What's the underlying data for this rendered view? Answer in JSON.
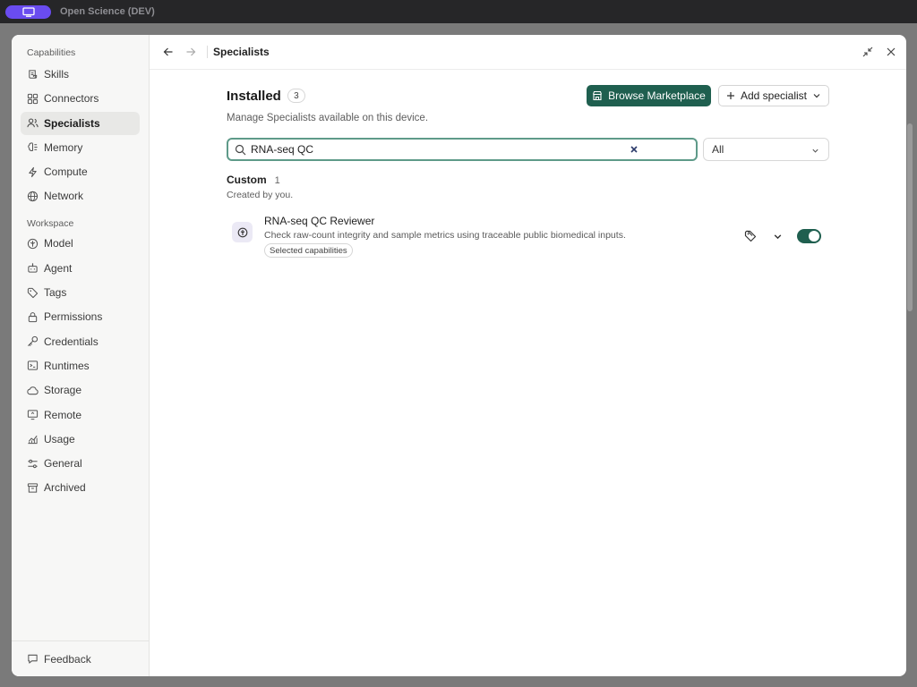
{
  "app": {
    "title": "Open Science (DEV)"
  },
  "sidebar": {
    "section1_label": "Capabilities",
    "items1": [
      {
        "label": "Skills",
        "icon": "scroll-icon"
      },
      {
        "label": "Connectors",
        "icon": "grid-icon"
      },
      {
        "label": "Specialists",
        "icon": "users-icon",
        "active": true
      },
      {
        "label": "Memory",
        "icon": "brain-icon"
      },
      {
        "label": "Compute",
        "icon": "lightning-icon"
      },
      {
        "label": "Network",
        "icon": "globe-icon"
      }
    ],
    "section2_label": "Workspace",
    "items2": [
      {
        "label": "Model",
        "icon": "model-icon"
      },
      {
        "label": "Agent",
        "icon": "robot-icon"
      },
      {
        "label": "Tags",
        "icon": "tag-icon"
      },
      {
        "label": "Permissions",
        "icon": "lock-icon"
      },
      {
        "label": "Credentials",
        "icon": "key-icon"
      },
      {
        "label": "Runtimes",
        "icon": "terminal-icon"
      },
      {
        "label": "Storage",
        "icon": "cloud-icon"
      },
      {
        "label": "Remote",
        "icon": "remote-icon"
      },
      {
        "label": "Usage",
        "icon": "chart-icon"
      },
      {
        "label": "General",
        "icon": "sliders-icon"
      },
      {
        "label": "Archived",
        "icon": "archive-icon"
      }
    ],
    "feedback_label": "Feedback"
  },
  "topbar": {
    "title": "Specialists"
  },
  "main": {
    "heading": "Installed",
    "installed_count": "3",
    "browse_label": "Browse Marketplace",
    "add_label": "Add specialist",
    "subtitle": "Manage Specialists available on this device.",
    "search_value": "RNA-seq QC",
    "filter_value": "All",
    "group": {
      "name": "Custom",
      "count": "1",
      "subtitle": "Created by you."
    },
    "specialist": {
      "name": "RNA-seq QC Reviewer",
      "description": "Check raw-count integrity and sample metrics using traceable public biomedical inputs.",
      "chip": "Selected capabilities",
      "enabled": true
    }
  },
  "colors": {
    "accent": "#1f5f4f",
    "search_border": "#5e9a89",
    "app_pill": "#6a4cf0"
  }
}
